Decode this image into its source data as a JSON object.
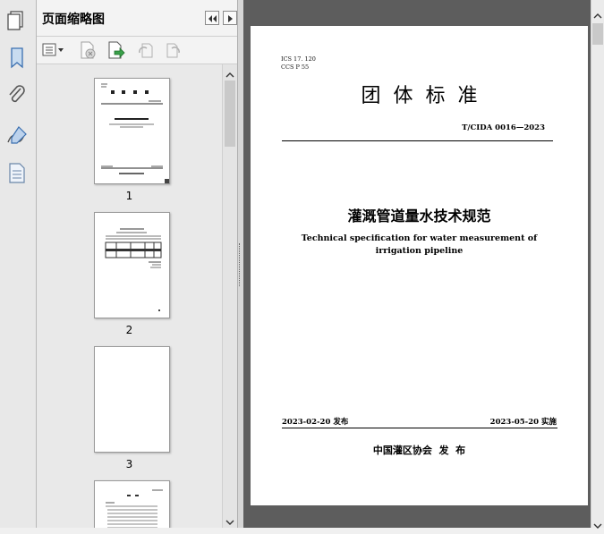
{
  "sidebar": {
    "panel_title": "页面缩略图",
    "thumbnails": [
      {
        "page_number": "1"
      },
      {
        "page_number": "2"
      },
      {
        "page_number": "3"
      }
    ]
  },
  "document": {
    "ics": "ICS 17. 120",
    "ccs": "CCS P 55",
    "header_title": "团  体  标  准",
    "standard_number": "T/CIDA 0016—2023",
    "title_cn": "灌溉管道量水技术规范",
    "title_en_line1": "Technical specification for water measurement of",
    "title_en_line2": "irrigation pipeline",
    "release_date": "2023-02-20 发布",
    "implement_date": "2023-05-20 实施",
    "publisher": "中国灌区协会  发  布"
  },
  "colors": {
    "accent_blue": "#3a6fb0",
    "doc_background": "#5d5d5d"
  }
}
